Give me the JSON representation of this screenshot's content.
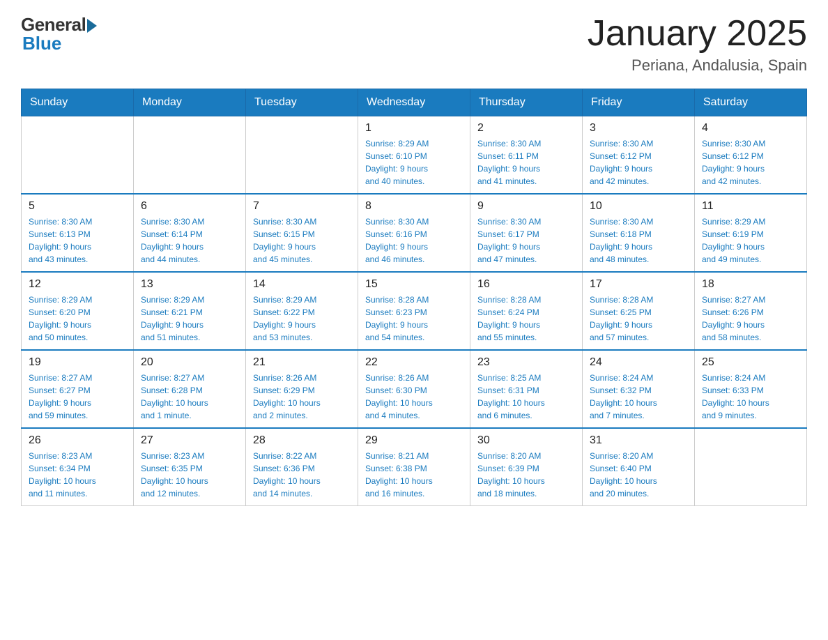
{
  "header": {
    "logo_general": "General",
    "logo_blue": "Blue",
    "month_title": "January 2025",
    "location": "Periana, Andalusia, Spain"
  },
  "days_of_week": [
    "Sunday",
    "Monday",
    "Tuesday",
    "Wednesday",
    "Thursday",
    "Friday",
    "Saturday"
  ],
  "weeks": [
    [
      {
        "day": "",
        "info": ""
      },
      {
        "day": "",
        "info": ""
      },
      {
        "day": "",
        "info": ""
      },
      {
        "day": "1",
        "info": "Sunrise: 8:29 AM\nSunset: 6:10 PM\nDaylight: 9 hours\nand 40 minutes."
      },
      {
        "day": "2",
        "info": "Sunrise: 8:30 AM\nSunset: 6:11 PM\nDaylight: 9 hours\nand 41 minutes."
      },
      {
        "day": "3",
        "info": "Sunrise: 8:30 AM\nSunset: 6:12 PM\nDaylight: 9 hours\nand 42 minutes."
      },
      {
        "day": "4",
        "info": "Sunrise: 8:30 AM\nSunset: 6:12 PM\nDaylight: 9 hours\nand 42 minutes."
      }
    ],
    [
      {
        "day": "5",
        "info": "Sunrise: 8:30 AM\nSunset: 6:13 PM\nDaylight: 9 hours\nand 43 minutes."
      },
      {
        "day": "6",
        "info": "Sunrise: 8:30 AM\nSunset: 6:14 PM\nDaylight: 9 hours\nand 44 minutes."
      },
      {
        "day": "7",
        "info": "Sunrise: 8:30 AM\nSunset: 6:15 PM\nDaylight: 9 hours\nand 45 minutes."
      },
      {
        "day": "8",
        "info": "Sunrise: 8:30 AM\nSunset: 6:16 PM\nDaylight: 9 hours\nand 46 minutes."
      },
      {
        "day": "9",
        "info": "Sunrise: 8:30 AM\nSunset: 6:17 PM\nDaylight: 9 hours\nand 47 minutes."
      },
      {
        "day": "10",
        "info": "Sunrise: 8:30 AM\nSunset: 6:18 PM\nDaylight: 9 hours\nand 48 minutes."
      },
      {
        "day": "11",
        "info": "Sunrise: 8:29 AM\nSunset: 6:19 PM\nDaylight: 9 hours\nand 49 minutes."
      }
    ],
    [
      {
        "day": "12",
        "info": "Sunrise: 8:29 AM\nSunset: 6:20 PM\nDaylight: 9 hours\nand 50 minutes."
      },
      {
        "day": "13",
        "info": "Sunrise: 8:29 AM\nSunset: 6:21 PM\nDaylight: 9 hours\nand 51 minutes."
      },
      {
        "day": "14",
        "info": "Sunrise: 8:29 AM\nSunset: 6:22 PM\nDaylight: 9 hours\nand 53 minutes."
      },
      {
        "day": "15",
        "info": "Sunrise: 8:28 AM\nSunset: 6:23 PM\nDaylight: 9 hours\nand 54 minutes."
      },
      {
        "day": "16",
        "info": "Sunrise: 8:28 AM\nSunset: 6:24 PM\nDaylight: 9 hours\nand 55 minutes."
      },
      {
        "day": "17",
        "info": "Sunrise: 8:28 AM\nSunset: 6:25 PM\nDaylight: 9 hours\nand 57 minutes."
      },
      {
        "day": "18",
        "info": "Sunrise: 8:27 AM\nSunset: 6:26 PM\nDaylight: 9 hours\nand 58 minutes."
      }
    ],
    [
      {
        "day": "19",
        "info": "Sunrise: 8:27 AM\nSunset: 6:27 PM\nDaylight: 9 hours\nand 59 minutes."
      },
      {
        "day": "20",
        "info": "Sunrise: 8:27 AM\nSunset: 6:28 PM\nDaylight: 10 hours\nand 1 minute."
      },
      {
        "day": "21",
        "info": "Sunrise: 8:26 AM\nSunset: 6:29 PM\nDaylight: 10 hours\nand 2 minutes."
      },
      {
        "day": "22",
        "info": "Sunrise: 8:26 AM\nSunset: 6:30 PM\nDaylight: 10 hours\nand 4 minutes."
      },
      {
        "day": "23",
        "info": "Sunrise: 8:25 AM\nSunset: 6:31 PM\nDaylight: 10 hours\nand 6 minutes."
      },
      {
        "day": "24",
        "info": "Sunrise: 8:24 AM\nSunset: 6:32 PM\nDaylight: 10 hours\nand 7 minutes."
      },
      {
        "day": "25",
        "info": "Sunrise: 8:24 AM\nSunset: 6:33 PM\nDaylight: 10 hours\nand 9 minutes."
      }
    ],
    [
      {
        "day": "26",
        "info": "Sunrise: 8:23 AM\nSunset: 6:34 PM\nDaylight: 10 hours\nand 11 minutes."
      },
      {
        "day": "27",
        "info": "Sunrise: 8:23 AM\nSunset: 6:35 PM\nDaylight: 10 hours\nand 12 minutes."
      },
      {
        "day": "28",
        "info": "Sunrise: 8:22 AM\nSunset: 6:36 PM\nDaylight: 10 hours\nand 14 minutes."
      },
      {
        "day": "29",
        "info": "Sunrise: 8:21 AM\nSunset: 6:38 PM\nDaylight: 10 hours\nand 16 minutes."
      },
      {
        "day": "30",
        "info": "Sunrise: 8:20 AM\nSunset: 6:39 PM\nDaylight: 10 hours\nand 18 minutes."
      },
      {
        "day": "31",
        "info": "Sunrise: 8:20 AM\nSunset: 6:40 PM\nDaylight: 10 hours\nand 20 minutes."
      },
      {
        "day": "",
        "info": ""
      }
    ]
  ]
}
